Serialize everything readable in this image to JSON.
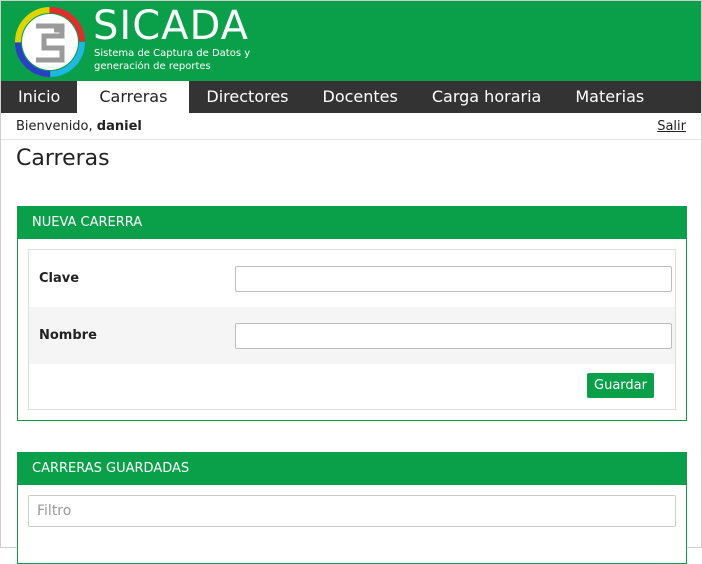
{
  "header": {
    "title": "SICADA",
    "subtitle": "Sistema de Captura de Datos y generación de reportes"
  },
  "nav": {
    "items": [
      "Inicio",
      "Carreras",
      "Directores",
      "Docentes",
      "Carga horaria",
      "Materias"
    ],
    "active_index": 1
  },
  "welcome": {
    "prefix": "Bienvenido,",
    "user": "daniel",
    "logout": "Salir"
  },
  "page": {
    "title": "Carreras"
  },
  "new_form": {
    "heading": "NUEVA CARERRA",
    "fields": [
      {
        "label": "Clave",
        "value": ""
      },
      {
        "label": "Nombre",
        "value": ""
      }
    ],
    "save_label": "Guardar"
  },
  "saved": {
    "heading": "CARRERAS GUARDADAS",
    "filter_placeholder": "Filtro"
  },
  "colors": {
    "brand": "#0aa04a",
    "nav": "#333333"
  }
}
